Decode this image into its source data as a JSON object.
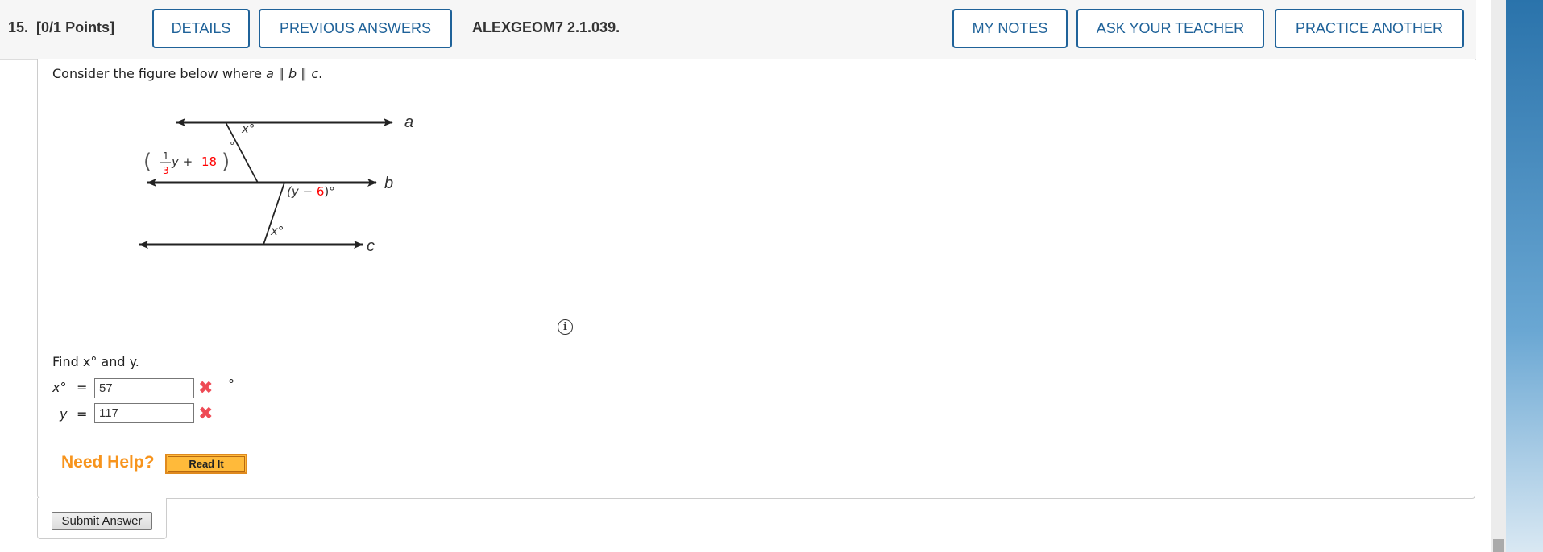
{
  "header": {
    "question_number": "15.",
    "points": "[0/1 Points]",
    "buttons": {
      "details": "DETAILS",
      "previous_answers": "PREVIOUS ANSWERS",
      "my_notes": "MY NOTES",
      "ask_teacher": "ASK YOUR TEACHER",
      "practice_another": "PRACTICE ANOTHER"
    },
    "problem_code": "ALEXGEOM7 2.1.039."
  },
  "question": {
    "prompt_prefix": "Consider the figure below where ",
    "prompt_math": "a ∥ b ∥ c",
    "prompt_suffix": ".",
    "figure": {
      "line_labels": [
        "a",
        "b",
        "c"
      ],
      "angle_top": "x°",
      "angle_left_num": "1",
      "angle_left_den": "3",
      "angle_left_var": "y + ",
      "angle_left_const": "18",
      "angle_mid_prefix": "(y − ",
      "angle_mid_const": "6",
      "angle_mid_suffix": ")°",
      "angle_bottom": "x°",
      "highlight_color": "#ff0000"
    },
    "find_text": "Find x° and y.",
    "answers": [
      {
        "label": "x°",
        "value": "57",
        "status": "incorrect",
        "unit": "°"
      },
      {
        "label": "y",
        "value": "117",
        "status": "incorrect",
        "unit": ""
      }
    ]
  },
  "help": {
    "label": "Need Help?",
    "read_it": "Read It"
  },
  "submit_label": "Submit Answer",
  "colors": {
    "accent": "#1f6299",
    "help": "#f7941d",
    "error": "#ee4b55"
  }
}
